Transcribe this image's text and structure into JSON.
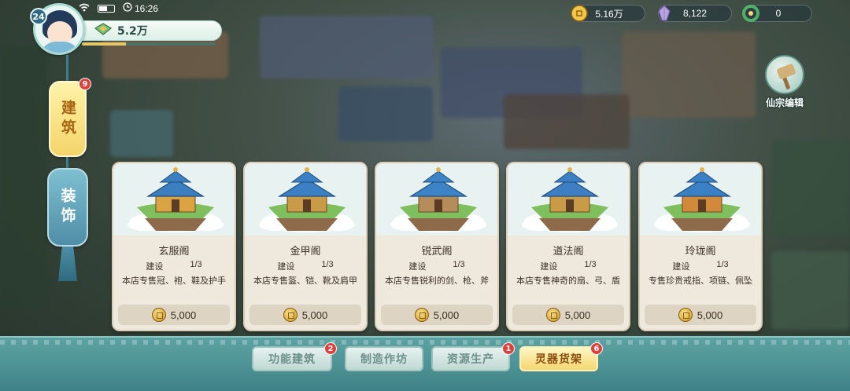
{
  "status": {
    "time": "16:26"
  },
  "player": {
    "level": "24",
    "power": "5.2万",
    "exp_fraction": 0.33
  },
  "currencies": [
    {
      "value": "5.16万",
      "icon": "gold-coin-icon"
    },
    {
      "value": "8,122",
      "icon": "spirit-crystal-icon"
    },
    {
      "value": "0",
      "icon": "jade-ring-icon"
    }
  ],
  "side_tabs": {
    "build": {
      "label": "建筑",
      "badge": "9"
    },
    "decorate": {
      "label": "装饰"
    }
  },
  "sect_edit": {
    "label": "仙宗编辑"
  },
  "shops": [
    {
      "name": "玄服阁",
      "build_label": "建设",
      "progress": "1/3",
      "desc": "本店专售冠、袍、鞋及护手",
      "price": "5,000",
      "roof": "#3b7fc0",
      "accent": "#d9a441"
    },
    {
      "name": "金甲阁",
      "build_label": "建设",
      "progress": "1/3",
      "desc": "本店专售盔、铠、靴及肩甲",
      "price": "5,000",
      "roof": "#3b80c4",
      "accent": "#c99b47"
    },
    {
      "name": "锐武阁",
      "build_label": "建设",
      "progress": "1/3",
      "desc": "本店专售锐利的剑、枪、斧",
      "price": "5,000",
      "roof": "#3c84c6",
      "accent": "#b58d5a"
    },
    {
      "name": "道法阁",
      "build_label": "建设",
      "progress": "1/3",
      "desc": "本店专售神奇的扇、弓、盾",
      "price": "5,000",
      "roof": "#3d7fc2",
      "accent": "#c99b47"
    },
    {
      "name": "玲珑阁",
      "build_label": "建设",
      "progress": "1/3",
      "desc": "专售珍贵戒指、项链、佩坠",
      "price": "5,000",
      "roof": "#3a80c4",
      "accent": "#d28a3a"
    }
  ],
  "bottom_tabs": [
    {
      "label": "功能建筑",
      "badge": "2",
      "active": false
    },
    {
      "label": "制造作坊",
      "badge": "",
      "active": false
    },
    {
      "label": "资源生产",
      "badge": "1",
      "active": false
    },
    {
      "label": "灵器货架",
      "badge": "6",
      "active": true
    }
  ]
}
